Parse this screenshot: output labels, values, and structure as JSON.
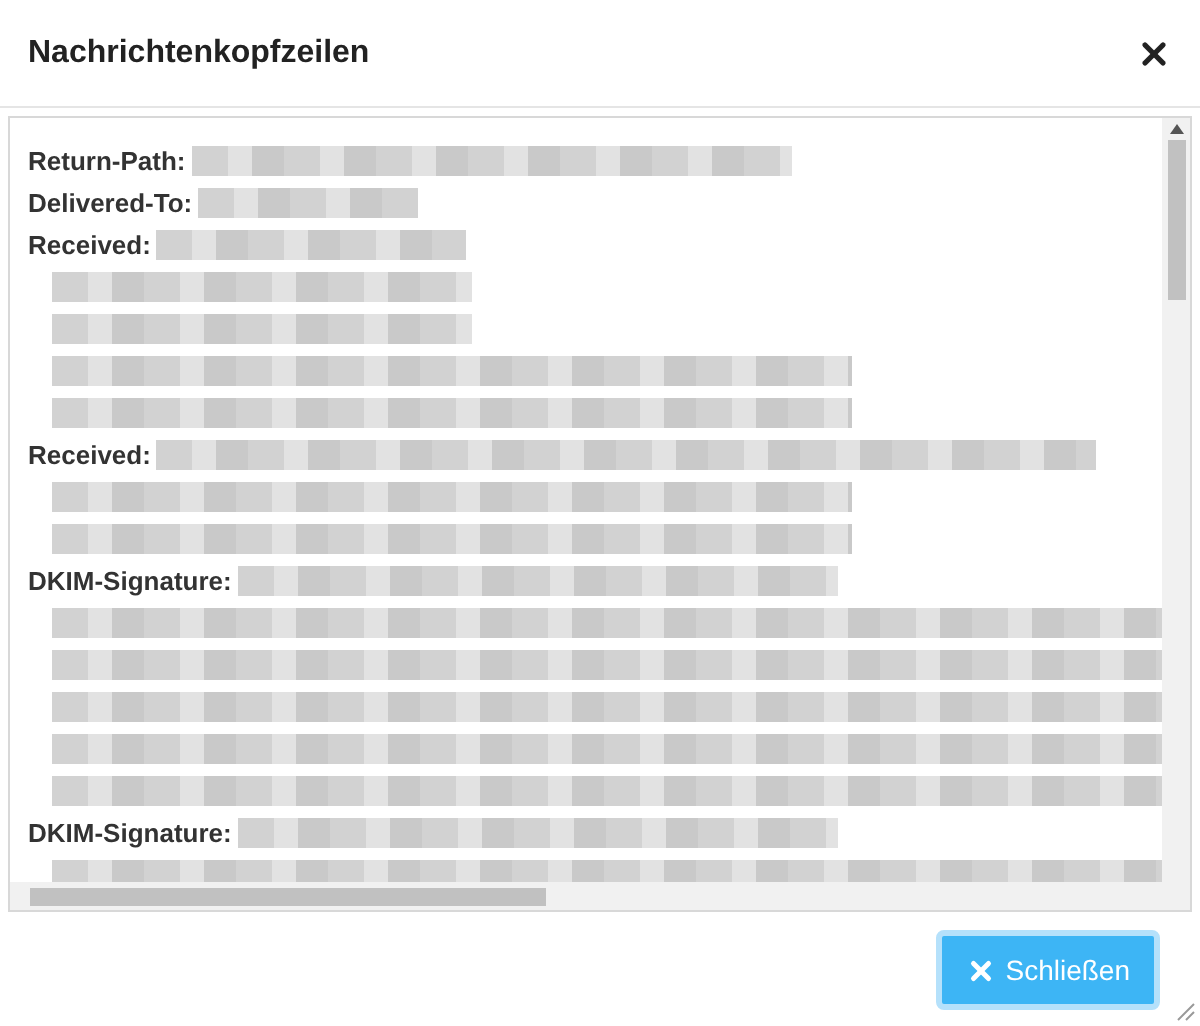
{
  "dialog": {
    "title": "Nachrichtenkopfzeilen"
  },
  "headers": [
    {
      "name": "Return-Path:",
      "value": {
        "kind": "long"
      }
    },
    {
      "name": "Delivered-To:",
      "value": {
        "kind": "short"
      }
    },
    {
      "name": "Received:",
      "value": {
        "kind": "medium"
      },
      "lines": [
        {
          "kind": "medium"
        },
        {
          "kind": "medium"
        },
        {
          "kind": "long"
        },
        {
          "kind": "long"
        }
      ]
    },
    {
      "name": "Received:",
      "value": {
        "kind": "full"
      },
      "lines": [
        {
          "kind": "long"
        },
        {
          "kind": "long"
        }
      ]
    },
    {
      "name": "DKIM-Signature:",
      "value": {
        "kind": "long"
      },
      "lines": [
        {
          "kind": "full"
        },
        {
          "kind": "full"
        },
        {
          "kind": "full"
        },
        {
          "kind": "full"
        },
        {
          "kind": "full"
        }
      ]
    },
    {
      "name": "DKIM-Signature:",
      "value": {
        "kind": "long"
      },
      "lines": [
        {
          "kind": "full"
        }
      ]
    }
  ],
  "close_button": {
    "label": "Schließen"
  }
}
